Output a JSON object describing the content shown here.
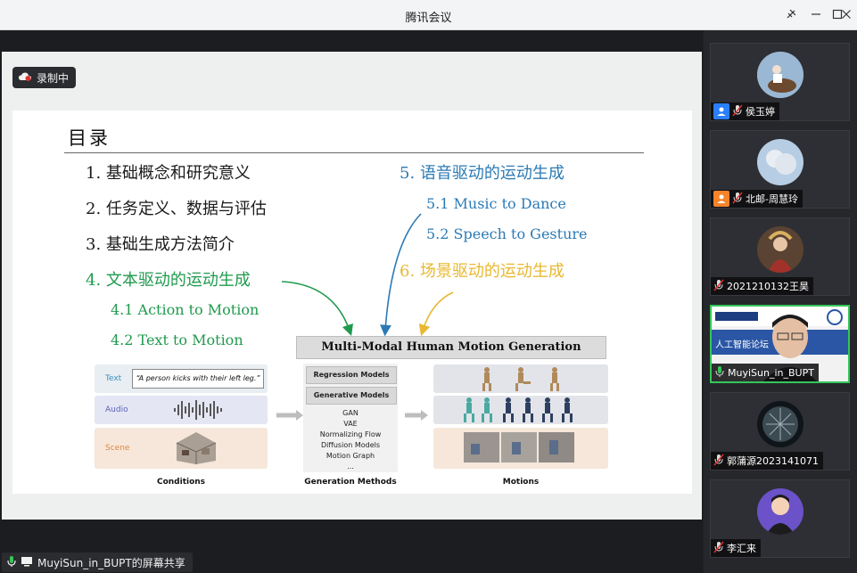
{
  "window": {
    "title": "腾讯会议",
    "controls": [
      "pin-icon",
      "minimize-icon",
      "maximize-icon",
      "close-icon"
    ]
  },
  "recording": {
    "label": "录制中",
    "icon": "record-cloud-icon"
  },
  "slide": {
    "heading": "目录",
    "left_items": [
      "1. 基础概念和研究意义",
      "2. 任务定义、数据与评估",
      "3. 基础生成方法简介"
    ],
    "text_driven": {
      "label": "4. 文本驱动的运动生成",
      "subs": [
        "4.1 Action to Motion",
        "4.2 Text to Motion"
      ]
    },
    "speech_driven": {
      "label": "5. 语音驱动的运动生成",
      "subs": [
        "5.1 Music to Dance",
        "5.2 Speech to Gesture"
      ]
    },
    "scene_driven": {
      "label": "6. 场景驱动的运动生成"
    },
    "figure": {
      "title": "Multi-Modal Human Motion Generation",
      "conditions": {
        "text_label": "Text",
        "text_quote": "“A person kicks with their left leg.”",
        "audio_label": "Audio",
        "scene_label": "Scene",
        "caption": "Conditions"
      },
      "methods": {
        "regression": "Regression Models",
        "generative": "Generative Models",
        "list": [
          "GAN",
          "VAE",
          "Normalizing Flow",
          "Diffusion Models",
          "Motion Graph",
          "..."
        ],
        "caption": "Generation Methods"
      },
      "motions": {
        "caption": "Motions"
      }
    },
    "colors": {
      "green": "#1f9a4d",
      "blue": "#2b7ab5",
      "yellow": "#e8b830"
    }
  },
  "screen_share": {
    "label": "MuyiSun_in_BUPT的屏幕共享"
  },
  "participants": [
    {
      "name": "侯玉婷",
      "role": "host",
      "muted": true,
      "avatar": "horse-rider-photo"
    },
    {
      "name": "北邮-周慧玲",
      "role": "cohost",
      "muted": true,
      "avatar": "sky-photo"
    },
    {
      "name": "2021210132王昊",
      "role": "",
      "muted": true,
      "avatar": "anime-figure-photo"
    },
    {
      "name": "MuyiSun_in_BUPT",
      "role": "",
      "muted": false,
      "speaking": true,
      "video_banner": "人工智能论坛",
      "avatar": "camera-video"
    },
    {
      "name": "郭蒲源2023141071",
      "role": "",
      "muted": true,
      "avatar": "planet-photo"
    },
    {
      "name": "李汇来",
      "role": "",
      "muted": true,
      "avatar": "cartoon-avatar"
    }
  ]
}
